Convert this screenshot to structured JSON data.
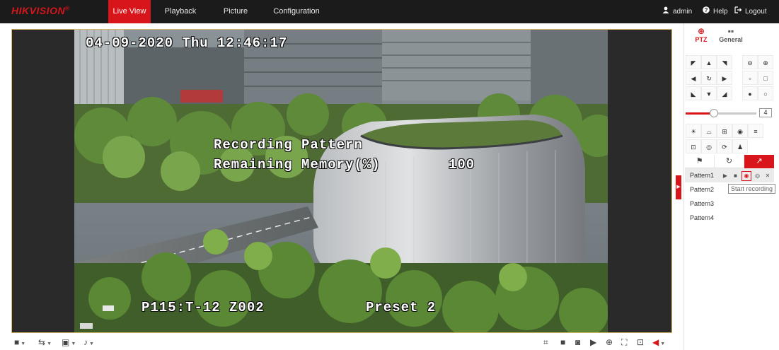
{
  "header": {
    "logo": "HIKVISION",
    "logo_mark": "®",
    "tabs": [
      {
        "label": "Live View"
      },
      {
        "label": "Playback"
      },
      {
        "label": "Picture"
      },
      {
        "label": "Configuration"
      }
    ],
    "user": "admin",
    "help": "Help",
    "logout": "Logout"
  },
  "video": {
    "osd_datetime": "04-09-2020 Thu 12:46:17",
    "osd_recording": "Recording Pattern",
    "osd_memory_label": "Remaining Memory(%)",
    "osd_memory_value": "100",
    "osd_camera": "P115:T-12 Z002",
    "osd_preset": "Preset 2"
  },
  "ptz_panel": {
    "tabs": [
      {
        "label": "PTZ",
        "icon": "ptz-icon"
      },
      {
        "label": "General",
        "icon": "grid-icon"
      }
    ],
    "speed_value": "4",
    "speed_fraction": 0.4,
    "sub_tabs": [
      "preset-icon",
      "patrol-icon",
      "pattern-icon"
    ],
    "patterns": [
      {
        "label": "Pattern1"
      },
      {
        "label": "Pattern2"
      },
      {
        "label": "Pattern3"
      },
      {
        "label": "Pattern4"
      }
    ],
    "tooltip": "Start recording"
  },
  "colors": {
    "accent": "#d7151b",
    "topbar": "#1b1b1b"
  }
}
